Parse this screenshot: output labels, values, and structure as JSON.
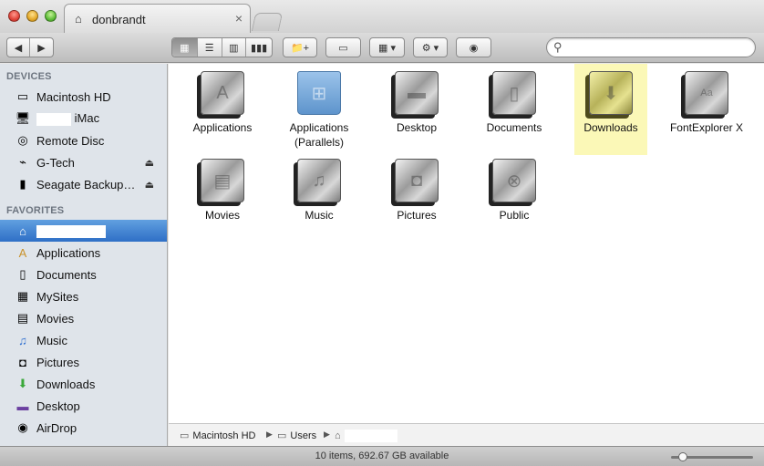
{
  "window": {
    "tab_title": "donbrandt",
    "tab_close": "×"
  },
  "toolbar": {
    "back": "◀",
    "forward": "▶",
    "view_icon": "▦",
    "view_list": "☰",
    "view_columns": "▥",
    "view_coverflow": "▮▮▮",
    "new_folder": "📁+",
    "toggle": "▭",
    "arrange": "▦ ▾",
    "action": "⚙ ▾",
    "quicklook": "◉",
    "search_placeholder": ""
  },
  "sidebar": {
    "devices_header": "DEVICES",
    "devices": [
      {
        "label": "Macintosh HD",
        "icon": "harddisk-icon"
      },
      {
        "label": "iMac",
        "icon": "imac-icon"
      },
      {
        "label": "Remote Disc",
        "icon": "disc-icon"
      },
      {
        "label": "G-Tech",
        "icon": "drive-icon",
        "eject": "⏏"
      },
      {
        "label": "Seagate Backup…",
        "icon": "drive-icon",
        "eject": "⏏"
      }
    ],
    "favorites_header": "FAVORITES",
    "favorites": [
      {
        "label": "",
        "icon": "home-icon"
      },
      {
        "label": "Applications",
        "icon": "applications-icon"
      },
      {
        "label": "Documents",
        "icon": "documents-icon"
      },
      {
        "label": "MySites",
        "icon": "mysites-icon"
      },
      {
        "label": "Movies",
        "icon": "movies-icon"
      },
      {
        "label": "Music",
        "icon": "music-icon"
      },
      {
        "label": "Pictures",
        "icon": "pictures-icon"
      },
      {
        "label": "Downloads",
        "icon": "downloads-icon"
      },
      {
        "label": "Desktop",
        "icon": "desktop-icon"
      },
      {
        "label": "AirDrop",
        "icon": "airdrop-icon"
      }
    ]
  },
  "content": {
    "items": [
      {
        "label": "Applications",
        "icon": "applications-folder-icon"
      },
      {
        "label": "Applications (Parallels)",
        "icon": "parallels-folder-icon"
      },
      {
        "label": "Desktop",
        "icon": "desktop-folder-icon"
      },
      {
        "label": "Documents",
        "icon": "documents-folder-icon"
      },
      {
        "label": "Downloads",
        "icon": "downloads-folder-icon"
      },
      {
        "label": "FontExplorer X",
        "icon": "fontexplorer-folder-icon"
      },
      {
        "label": "Movies",
        "icon": "movies-folder-icon"
      },
      {
        "label": "Music",
        "icon": "music-folder-icon"
      },
      {
        "label": "Pictures",
        "icon": "pictures-folder-icon"
      },
      {
        "label": "Public",
        "icon": "public-folder-icon"
      }
    ]
  },
  "pathbar": {
    "crumbs": [
      "Macintosh HD",
      "Users",
      ""
    ],
    "sep": "▶"
  },
  "statusbar": {
    "text": "10 items, 692.67 GB available"
  }
}
